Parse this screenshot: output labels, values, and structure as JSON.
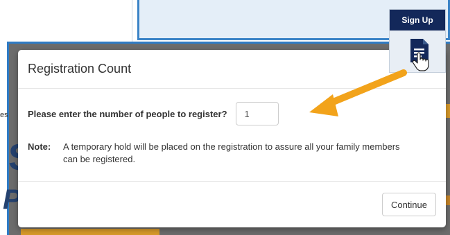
{
  "background": {
    "text_fragment": "es",
    "big_letter_top": "S",
    "big_letter_bottom": "Pa"
  },
  "dialog": {
    "title": "Registration Count",
    "question_label": "Please enter the number of people to register?",
    "count_value": "1",
    "note_label": "Note:",
    "note_text": "A temporary hold will be placed on the registration to assure all your family members can be registered.",
    "continue_label": "Continue"
  },
  "signup": {
    "label": "Sign Up",
    "icon": "document-icon",
    "cursor": "hand-pointer-icon"
  },
  "colors": {
    "accent": "#2f7bc4",
    "signup_header": "#13285a",
    "arrow": "#f2a31b"
  }
}
